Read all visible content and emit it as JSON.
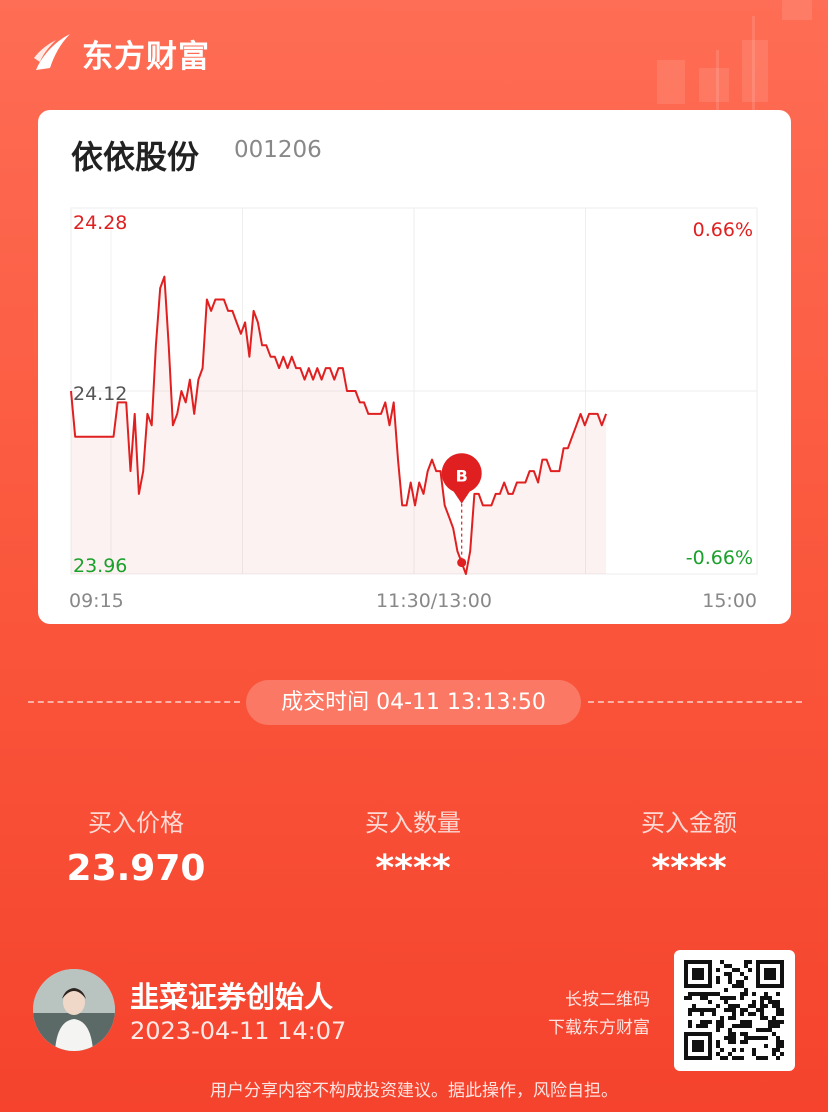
{
  "brand": {
    "name": "东方财富"
  },
  "stock": {
    "name": "依依股份",
    "code": "001206"
  },
  "chart_data": {
    "type": "line",
    "y_axis_left": [
      "24.28",
      "24.12",
      "23.96"
    ],
    "y_axis_right": [
      "0.66%",
      "-0.66%"
    ],
    "x_axis": [
      "09:15",
      "11:30/13:00",
      "15:00"
    ],
    "ylim": [
      23.96,
      24.28
    ],
    "x_session_fraction_filled": 0.78,
    "trade_marker": {
      "label": "B",
      "price": 23.97,
      "time": "13:13:50"
    },
    "series": [
      {
        "values": [
          24.12,
          24.08,
          24.08,
          24.08,
          24.08,
          24.08,
          24.08,
          24.08,
          24.08,
          24.08,
          24.08,
          24.11,
          24.11,
          24.11,
          24.05,
          24.1,
          24.03,
          24.05,
          24.1,
          24.09,
          24.16,
          24.21,
          24.22,
          24.16,
          24.09,
          24.1,
          24.12,
          24.11,
          24.13,
          24.1,
          24.13,
          24.14,
          24.2,
          24.19,
          24.2,
          24.2,
          24.2,
          24.19,
          24.19,
          24.18,
          24.17,
          24.18,
          24.15,
          24.19,
          24.18,
          24.16,
          24.16,
          24.15,
          24.15,
          24.14,
          24.15,
          24.14,
          24.15,
          24.14,
          24.14,
          24.13,
          24.14,
          24.13,
          24.14,
          24.13,
          24.14,
          24.14,
          24.13,
          24.14,
          24.14,
          24.12,
          24.12,
          24.12,
          24.11,
          24.11,
          24.1,
          24.1,
          24.1,
          24.1,
          24.11,
          24.09,
          24.11,
          24.06,
          24.02,
          24.02,
          24.04,
          24.02,
          24.04,
          24.03,
          24.05,
          24.06,
          24.05,
          24.05,
          24.02,
          24.01,
          24.0,
          23.98,
          23.97,
          23.96,
          23.98,
          24.03,
          24.03,
          24.02,
          24.02,
          24.02,
          24.03,
          24.03,
          24.04,
          24.03,
          24.03,
          24.04,
          24.04,
          24.04,
          24.05,
          24.05,
          24.04,
          24.06,
          24.06,
          24.05,
          24.05,
          24.05,
          24.07,
          24.07,
          24.08,
          24.09,
          24.1,
          24.09,
          24.1,
          24.1,
          24.1,
          24.09,
          24.1
        ]
      }
    ]
  },
  "trade": {
    "time_label": "成交时间 04-11 13:13:50"
  },
  "stats": [
    {
      "label": "买入价格",
      "value": "23.970"
    },
    {
      "label": "买入数量",
      "value": "****"
    },
    {
      "label": "买入金额",
      "value": "****"
    }
  ],
  "user": {
    "name": "韭菜证券创始人",
    "time": "2023-04-11 14:07"
  },
  "qr_hint": {
    "line1": "长按二维码",
    "line2": "下载东方财富"
  },
  "disclaimer": "用户分享内容不构成投资建议。据此操作，风险自担。",
  "colors": {
    "background": "#fb5a3f",
    "line": "#e02020",
    "up": "#e02020",
    "down": "#1aa12b"
  }
}
